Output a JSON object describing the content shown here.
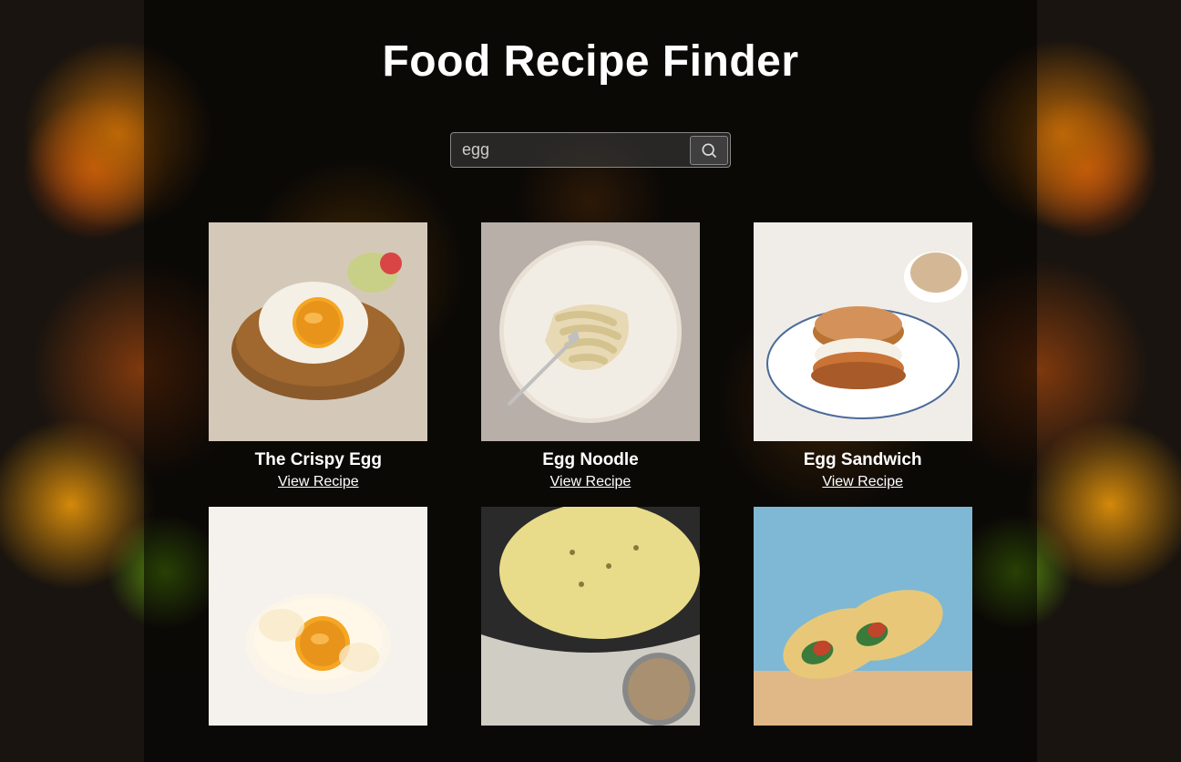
{
  "title": "Food Recipe Finder",
  "search": {
    "value": "egg",
    "placeholder": ""
  },
  "view_recipe_label": "View Recipe",
  "recipes": [
    {
      "title": "The Crispy Egg"
    },
    {
      "title": "Egg Noodle"
    },
    {
      "title": "Egg Sandwich"
    },
    {
      "title": ""
    },
    {
      "title": ""
    },
    {
      "title": ""
    }
  ]
}
